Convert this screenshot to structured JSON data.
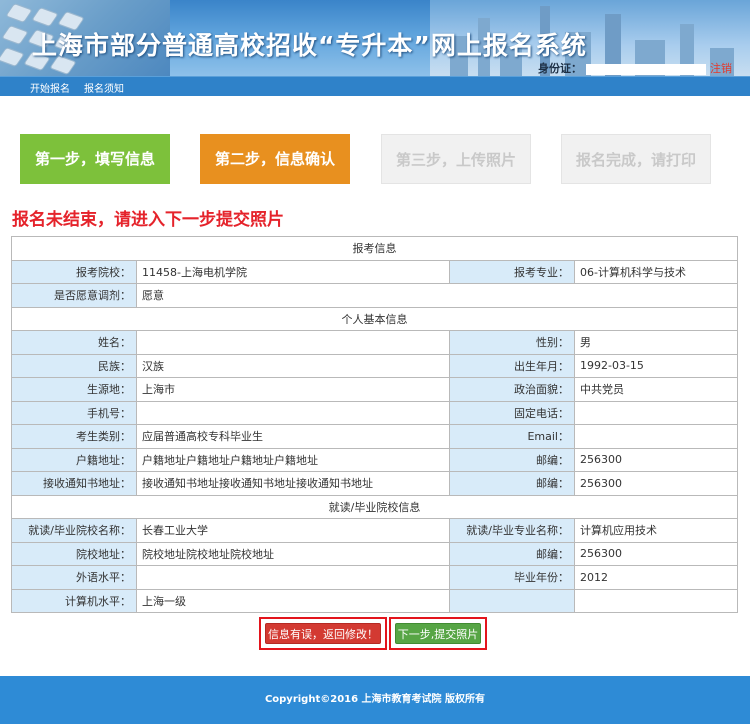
{
  "header": {
    "title": "上海市部分普通高校招收“专升本”网上报名系统",
    "id_label": "身份证：",
    "logout": "注销"
  },
  "nav": {
    "items": [
      "开始报名",
      "报名须知"
    ]
  },
  "steps": [
    {
      "label": "第一步，填写信息",
      "state": "done"
    },
    {
      "label": "第二步，信息确认",
      "state": "active"
    },
    {
      "label": "第三步，上传照片",
      "state": "todo"
    },
    {
      "label": "报名完成，请打印",
      "state": "todo"
    }
  ],
  "notice": "报名未结束，请进入下一步提交照片",
  "sections": {
    "apply": "报考信息",
    "personal": "个人基本信息",
    "school": "就读/毕业院校信息"
  },
  "apply": {
    "school_label": "报考院校：",
    "school_value": "11458-上海电机学院",
    "major_label": "报考专业：",
    "major_value": "06-计算机科学与技术",
    "adjust_label": "是否愿意调剂：",
    "adjust_value": "愿意"
  },
  "personal": {
    "name_label": "姓名：",
    "name_value": "",
    "gender_label": "性别：",
    "gender_value": "男",
    "ethnic_label": "民族：",
    "ethnic_value": "汉族",
    "birth_label": "出生年月：",
    "birth_value": "1992-03-15",
    "origin_label": "生源地：",
    "origin_value": "上海市",
    "political_label": "政治面貌：",
    "political_value": "中共党员",
    "mobile_label": "手机号：",
    "mobile_value": "",
    "phone_label": "固定电话：",
    "phone_value": "",
    "category_label": "考生类别：",
    "category_value": "应届普通高校专科毕业生",
    "email_label": "Email：",
    "email_value": "",
    "household_label": "户籍地址：",
    "household_value": "户籍地址户籍地址户籍地址户籍地址",
    "zip1_label": "邮编：",
    "zip1_value": "256300",
    "notice_addr_label": "接收通知书地址：",
    "notice_addr_value": "接收通知书地址接收通知书地址接收通知书地址",
    "zip2_label": "邮编：",
    "zip2_value": "256300"
  },
  "school": {
    "school_label": "就读/毕业院校名称：",
    "school_value": "长春工业大学",
    "major_label": "就读/毕业专业名称：",
    "major_value": "计算机应用技术",
    "addr_label": "院校地址：",
    "addr_value": "院校地址院校地址院校地址",
    "zip_label": "邮编：",
    "zip_value": "256300",
    "lang_label": "外语水平：",
    "lang_value": "",
    "grad_label": "毕业年份：",
    "grad_value": "2012",
    "computer_label": "计算机水平：",
    "computer_value": "上海一级"
  },
  "buttons": {
    "back": "信息有误，返回修改！",
    "next": "下一步,提交照片"
  },
  "footer": "Copyright©2016 上海市教育考试院 版权所有",
  "colors": {
    "header_blue": "#3a84c9",
    "nav_blue": "#2f82c9",
    "step_done": "#7dc13b",
    "step_active": "#e8901f",
    "step_todo": "#f1f1f1",
    "notice_red": "#e5232b",
    "label_bg": "#d8ebf9",
    "btn_back": "#d33a32",
    "btn_next": "#57a545",
    "footer_blue": "#2e8bd6"
  }
}
